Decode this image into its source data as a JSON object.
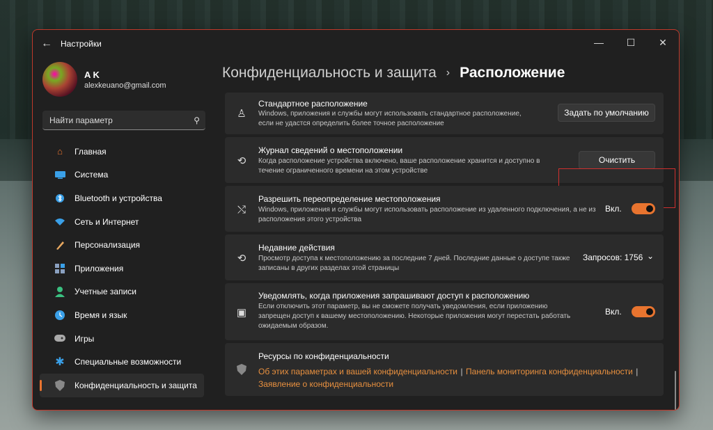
{
  "window": {
    "title": "Настройки",
    "back_icon": "back-arrow-icon"
  },
  "profile": {
    "name": "A K",
    "email": "alexkeuano@gmail.com"
  },
  "search": {
    "placeholder": "Найти параметр"
  },
  "sidebar": {
    "items": [
      {
        "label": "Главная",
        "icon": "home-icon",
        "color": "#e8742f"
      },
      {
        "label": "Система",
        "icon": "system-icon",
        "color": "#3aa0e8"
      },
      {
        "label": "Bluetooth и устройства",
        "icon": "bluetooth-icon",
        "color": "#3aa0e8"
      },
      {
        "label": "Сеть и Интернет",
        "icon": "wifi-icon",
        "color": "#3aa0e8"
      },
      {
        "label": "Персонализация",
        "icon": "brush-icon",
        "color": "#e8a860"
      },
      {
        "label": "Приложения",
        "icon": "apps-icon",
        "color": "#8aa0c0"
      },
      {
        "label": "Учетные записи",
        "icon": "account-icon",
        "color": "#3ac080"
      },
      {
        "label": "Время и язык",
        "icon": "time-language-icon",
        "color": "#3aa0e8"
      },
      {
        "label": "Игры",
        "icon": "gamepad-icon",
        "color": "#aaaaaa"
      },
      {
        "label": "Специальные возможности",
        "icon": "accessibility-icon",
        "color": "#3aa0e8"
      },
      {
        "label": "Конфиденциальность и защита",
        "icon": "shield-icon",
        "color": "#888888",
        "active": true
      }
    ]
  },
  "breadcrumb": {
    "parent": "Конфиденциальность и защита",
    "separator": "›",
    "current": "Расположение"
  },
  "cards": {
    "default_location": {
      "title": "Стандартное расположение",
      "desc": "Windows, приложения и службы могут использовать стандартное расположение, если не удастся определить более точное расположение",
      "button": "Задать по умолчанию"
    },
    "history": {
      "title": "Журнал сведений о местоположении",
      "desc": "Когда расположение устройства включено, ваше расположение хранится и доступно в течение ограниченного времени на этом устройстве",
      "button": "Очистить"
    },
    "override": {
      "title": "Разрешить переопределение местоположения",
      "desc": "Windows, приложения и службы могут использовать расположение из удаленного подключения, а не из расположения этого устройства",
      "toggle_label": "Вкл.",
      "toggle_on": true
    },
    "recent": {
      "title": "Недавние действия",
      "desc": "Просмотр доступа к местоположению за последние 7 дней. Последние данные о доступе также записаны в других разделах этой страницы",
      "count_label": "Запросов: 1756"
    },
    "notify": {
      "title": "Уведомлять, когда приложения запрашивают доступ к расположению",
      "desc": "Если отключить этот параметр, вы не сможете получать уведомления, если приложению запрещен доступ к вашему местоположению. Некоторые приложения могут перестать работать ожидаемым образом.",
      "toggle_label": "Вкл.",
      "toggle_on": true
    },
    "resources": {
      "title": "Ресурсы по конфиденциальности",
      "link1": "Об этих параметрах и вашей конфиденциальности",
      "link2": "Панель мониторинга конфиденциальности",
      "link3": "Заявление о конфиденциальности",
      "separator": "|"
    }
  },
  "colors": {
    "accent": "#e8742f",
    "highlight": "#d0302f"
  }
}
